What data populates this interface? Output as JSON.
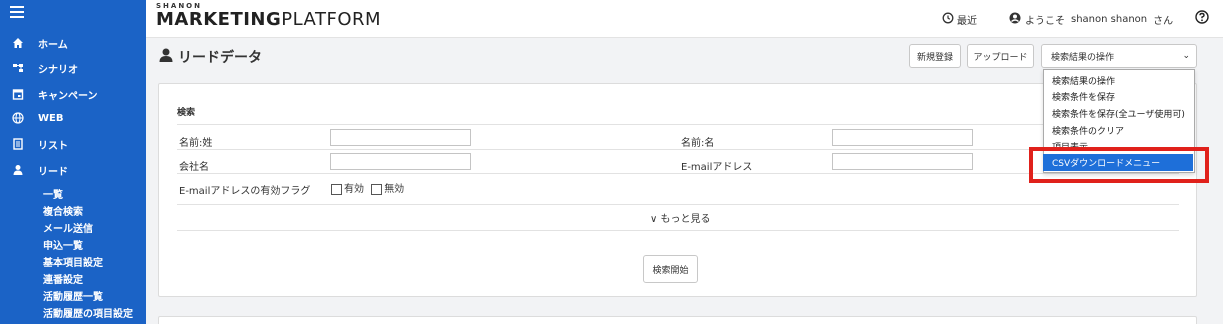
{
  "sidebar": {
    "items": [
      {
        "label": "ホーム",
        "icon": "home-icon"
      },
      {
        "label": "シナリオ",
        "icon": "scenario-icon"
      },
      {
        "label": "キャンペーン",
        "icon": "campaign-icon"
      },
      {
        "label": "WEB",
        "icon": "globe-icon"
      },
      {
        "label": "リスト",
        "icon": "list-icon"
      },
      {
        "label": "リード",
        "icon": "person-icon"
      }
    ],
    "subitems": [
      "一覧",
      "複合検索",
      "メール送信",
      "申込一覧",
      "基本項目設定",
      "連番設定",
      "活動履歴一覧",
      "活動履歴の項目設定"
    ]
  },
  "header": {
    "logo_top": "SHANON",
    "logo_main_bold": "MARKETING",
    "logo_main_rest": "PLATFORM",
    "recent": "最近",
    "welcome": "ようこそ",
    "user": "shanon shanon",
    "honorific": "さん"
  },
  "page": {
    "title": "リードデータ",
    "new_button": "新規登録",
    "upload_button": "アップロード",
    "action_select": "検索結果の操作"
  },
  "search": {
    "title": "検索",
    "last_name": "名前:姓",
    "first_name": "名前:名",
    "company": "会社名",
    "email": "E-mailアドレス",
    "email_flag": "E-mailアドレスの有効フラグ",
    "valid": "有効",
    "invalid": "無効",
    "more": "∨ もっと見る",
    "search_button": "検索開始"
  },
  "menu": {
    "items": [
      "検索結果の操作",
      "検索条件を保存",
      "検索条件を保存(全ユーザ使用可)",
      "検索条件のクリア",
      "項目表示"
    ],
    "highlighted": "CSVダウンロードメニュー"
  },
  "colors": {
    "sidebar": "#1b63c6",
    "highlight": "#1e6fd9",
    "annotation": "#e0211b"
  }
}
